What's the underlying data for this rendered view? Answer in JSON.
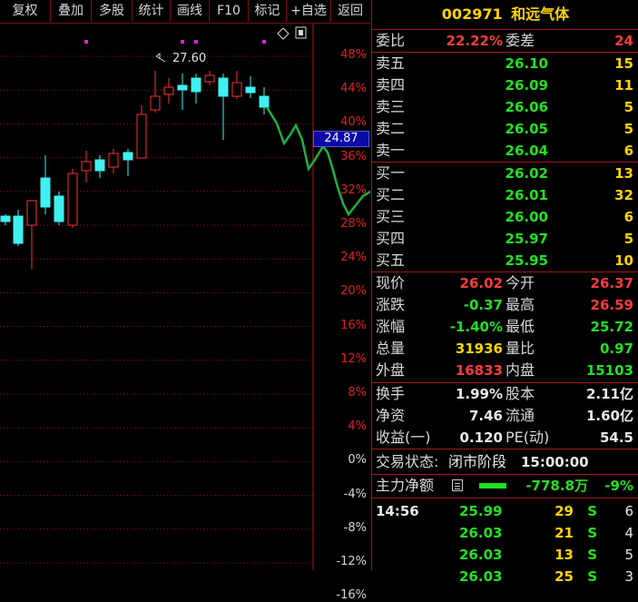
{
  "toolbar": {
    "buttons": [
      "复权",
      "叠加",
      "多股",
      "统计",
      "画线",
      "F10",
      "标记",
      "+自选",
      "返回"
    ],
    "diamond_icon": "diamond-icon",
    "square_icon": "window-icon"
  },
  "chart": {
    "y_ticks": [
      "48%",
      "44%",
      "40%",
      "36%",
      "32%",
      "28%",
      "24%",
      "20%",
      "16%",
      "12%",
      "8%",
      "4%",
      "0%",
      "-4%",
      "-8%",
      "-12%",
      "-16%"
    ],
    "high_label": "27.60",
    "current_price_tag": "24.87",
    "colors": {
      "up": "#ff3030",
      "down": "#40f0f0",
      "line": "#20b040",
      "grid": "#b01010"
    }
  },
  "panel": {
    "stock_code": "002971",
    "stock_name": "和远气体",
    "weibi": {
      "label": "委比",
      "value": "22.22%",
      "label2": "委差",
      "value2": "24"
    },
    "asks": [
      {
        "label": "卖五",
        "price": "26.10",
        "vol": "15"
      },
      {
        "label": "卖四",
        "price": "26.09",
        "vol": "11"
      },
      {
        "label": "卖三",
        "price": "26.06",
        "vol": "5"
      },
      {
        "label": "卖二",
        "price": "26.05",
        "vol": "5"
      },
      {
        "label": "卖一",
        "price": "26.04",
        "vol": "6"
      }
    ],
    "bids": [
      {
        "label": "买一",
        "price": "26.02",
        "vol": "13"
      },
      {
        "label": "买二",
        "price": "26.01",
        "vol": "32"
      },
      {
        "label": "买三",
        "price": "26.00",
        "vol": "6"
      },
      {
        "label": "买四",
        "price": "25.97",
        "vol": "5"
      },
      {
        "label": "买五",
        "price": "25.95",
        "vol": "10"
      }
    ],
    "quote": [
      {
        "l1": "现价",
        "v1": "26.02",
        "c1": "red",
        "l2": "今开",
        "v2": "26.37",
        "c2": "red"
      },
      {
        "l1": "涨跌",
        "v1": "-0.37",
        "c1": "green",
        "l2": "最高",
        "v2": "26.59",
        "c2": "red"
      },
      {
        "l1": "涨幅",
        "v1": "-1.40%",
        "c1": "green",
        "l2": "最低",
        "v2": "25.72",
        "c2": "green"
      },
      {
        "l1": "总量",
        "v1": "31936",
        "c1": "yellow",
        "l2": "量比",
        "v2": "0.97",
        "c2": "green"
      },
      {
        "l1": "外盘",
        "v1": "16833",
        "c1": "red",
        "l2": "内盘",
        "v2": "15103",
        "c2": "green"
      }
    ],
    "fund": [
      {
        "l1": "换手",
        "v1": "1.99%",
        "l2": "股本",
        "v2": "2.11亿"
      },
      {
        "l1": "净资",
        "v1": "7.46",
        "l2": "流通",
        "v2": "1.60亿"
      },
      {
        "l1": "收益(一)",
        "v1": "0.120",
        "l2": "PE(动)",
        "v2": "54.5"
      }
    ],
    "status": {
      "label": "交易状态:",
      "value": "闭市阶段",
      "time": "15:00:00"
    },
    "main_force": {
      "label": "主力净额",
      "value": "-778.8万",
      "pct": "-9%",
      "icon": "menu-icon"
    },
    "ticks": [
      {
        "time": "14:56",
        "price": "25.99",
        "vol": "29",
        "side": "S",
        "count": "6"
      },
      {
        "time": "",
        "price": "26.03",
        "vol": "21",
        "side": "S",
        "count": "4"
      },
      {
        "time": "",
        "price": "26.03",
        "vol": "13",
        "side": "S",
        "count": "5"
      },
      {
        "time": "",
        "price": "26.03",
        "vol": "25",
        "side": "S",
        "count": "3"
      }
    ]
  }
}
